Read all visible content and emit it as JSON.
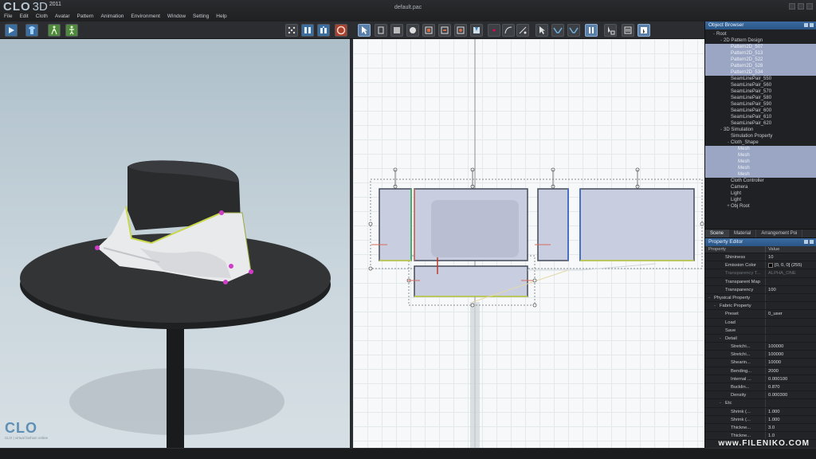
{
  "app": {
    "logo_text": "CLO",
    "version_text": "3D",
    "year": "2011",
    "document_title": "default.pac"
  },
  "menu": [
    "File",
    "Edit",
    "Cloth",
    "Avatar",
    "Pattern",
    "Animation",
    "Environment",
    "Window",
    "Setting",
    "Help"
  ],
  "watermark_3d": {
    "mark": "CLO",
    "tagline": "CLO | virtual fashion online"
  },
  "footer_watermark": "www.FILENIKO.COM",
  "colors": {
    "panel_header": "#2b5686",
    "tree_highlight": "#9aa6c4",
    "pattern_fill": "#c8cde0",
    "pattern_stroke": "#444a58",
    "avatar_dark": "#2a2b2d",
    "cloth_white": "#e8eaec",
    "seam_yellow": "#c8d84a",
    "point_magenta": "#d03cc8"
  },
  "object_browser": {
    "title": "Object Browser",
    "tree": [
      {
        "label": "Root",
        "depth": 0,
        "expander": "-",
        "hl": false
      },
      {
        "label": "2D Pattern Design",
        "depth": 1,
        "expander": "-",
        "hl": false
      },
      {
        "label": "Pattern2D_507",
        "depth": 2,
        "expander": "",
        "hl": true
      },
      {
        "label": "Pattern2D_513",
        "depth": 2,
        "expander": "",
        "hl": true
      },
      {
        "label": "Pattern2D_522",
        "depth": 2,
        "expander": "",
        "hl": true
      },
      {
        "label": "Pattern2D_528",
        "depth": 2,
        "expander": "",
        "hl": true
      },
      {
        "label": "Pattern2D_534",
        "depth": 2,
        "expander": "",
        "hl": true
      },
      {
        "label": "SeamLinePair_550",
        "depth": 2,
        "expander": "",
        "hl": false
      },
      {
        "label": "SeamLinePair_560",
        "depth": 2,
        "expander": "",
        "hl": false
      },
      {
        "label": "SeamLinePair_570",
        "depth": 2,
        "expander": "",
        "hl": false
      },
      {
        "label": "SeamLinePair_580",
        "depth": 2,
        "expander": "",
        "hl": false
      },
      {
        "label": "SeamLinePair_590",
        "depth": 2,
        "expander": "",
        "hl": false
      },
      {
        "label": "SeamLinePair_600",
        "depth": 2,
        "expander": "",
        "hl": false
      },
      {
        "label": "SeamLinePair_610",
        "depth": 2,
        "expander": "",
        "hl": false
      },
      {
        "label": "SeamLinePair_620",
        "depth": 2,
        "expander": "",
        "hl": false
      },
      {
        "label": "3D Simulation",
        "depth": 1,
        "expander": "-",
        "hl": false
      },
      {
        "label": "Simulation Property",
        "depth": 2,
        "expander": "",
        "hl": false
      },
      {
        "label": "Cloth_Shape",
        "depth": 2,
        "expander": "-",
        "hl": false
      },
      {
        "label": "Mesh",
        "depth": 3,
        "expander": "",
        "hl": true
      },
      {
        "label": "Mesh",
        "depth": 3,
        "expander": "",
        "hl": true
      },
      {
        "label": "Mesh",
        "depth": 3,
        "expander": "",
        "hl": true
      },
      {
        "label": "Mesh",
        "depth": 3,
        "expander": "",
        "hl": true
      },
      {
        "label": "Mesh",
        "depth": 3,
        "expander": "",
        "hl": true
      },
      {
        "label": "Cloth Controller",
        "depth": 2,
        "expander": "",
        "hl": false
      },
      {
        "label": "Camera",
        "depth": 2,
        "expander": "",
        "hl": false
      },
      {
        "label": "Light",
        "depth": 2,
        "expander": "",
        "hl": false
      },
      {
        "label": "Light",
        "depth": 2,
        "expander": "",
        "hl": false
      },
      {
        "label": "Obj Root",
        "depth": 2,
        "expander": "+",
        "hl": false
      }
    ]
  },
  "tabs": [
    "Scene",
    "Material",
    "Arrangement Poi"
  ],
  "property_editor": {
    "title": "Property Editor",
    "col_property": "Property",
    "col_value": "Value",
    "rows": [
      {
        "key": "Shininess",
        "value": "10",
        "depth": 2,
        "expander": "",
        "dim": false
      },
      {
        "key": "Emission Color",
        "value": "[0, 0, 0] (255)",
        "depth": 2,
        "expander": "",
        "dim": false,
        "swatch": true
      },
      {
        "key": "Transparency T...",
        "value": "ALPHA_ONE",
        "depth": 2,
        "expander": "",
        "dim": true
      },
      {
        "key": "Transparent Map",
        "value": "",
        "depth": 2,
        "expander": "",
        "dim": false
      },
      {
        "key": "Transparency",
        "value": "100",
        "depth": 2,
        "expander": "",
        "dim": false
      },
      {
        "key": "Physical Property",
        "value": "",
        "depth": 0,
        "expander": "-",
        "dim": false
      },
      {
        "key": "Fabric Property",
        "value": "",
        "depth": 1,
        "expander": "-",
        "dim": false
      },
      {
        "key": "Preset",
        "value": "0_user",
        "depth": 2,
        "expander": "",
        "dim": false
      },
      {
        "key": "Load",
        "value": "",
        "depth": 2,
        "expander": "",
        "dim": false
      },
      {
        "key": "Save",
        "value": "",
        "depth": 2,
        "expander": "",
        "dim": false
      },
      {
        "key": "Detail",
        "value": "",
        "depth": 2,
        "expander": "-",
        "dim": false
      },
      {
        "key": "Stretchi...",
        "value": "100000",
        "depth": 3,
        "expander": "",
        "dim": false
      },
      {
        "key": "Stretchi...",
        "value": "100000",
        "depth": 3,
        "expander": "",
        "dim": false
      },
      {
        "key": "Shearin...",
        "value": "10000",
        "depth": 3,
        "expander": "",
        "dim": false
      },
      {
        "key": "Bending...",
        "value": "2000",
        "depth": 3,
        "expander": "",
        "dim": false
      },
      {
        "key": "Internal ...",
        "value": "0.000100",
        "depth": 3,
        "expander": "",
        "dim": false
      },
      {
        "key": "Bucklin...",
        "value": "0.870",
        "depth": 3,
        "expander": "",
        "dim": false
      },
      {
        "key": "Density",
        "value": "0.000300",
        "depth": 3,
        "expander": "",
        "dim": false
      },
      {
        "key": "Etc",
        "value": "",
        "depth": 2,
        "expander": "-",
        "dim": false
      },
      {
        "key": "Shrink (...",
        "value": "1.000",
        "depth": 3,
        "expander": "",
        "dim": false
      },
      {
        "key": "Shrink (...",
        "value": "1.000",
        "depth": 3,
        "expander": "",
        "dim": false
      },
      {
        "key": "Thickne...",
        "value": "3.0",
        "depth": 3,
        "expander": "",
        "dim": false
      },
      {
        "key": "Thickne...",
        "value": "1.0",
        "depth": 3,
        "expander": "",
        "dim": false
      }
    ]
  }
}
